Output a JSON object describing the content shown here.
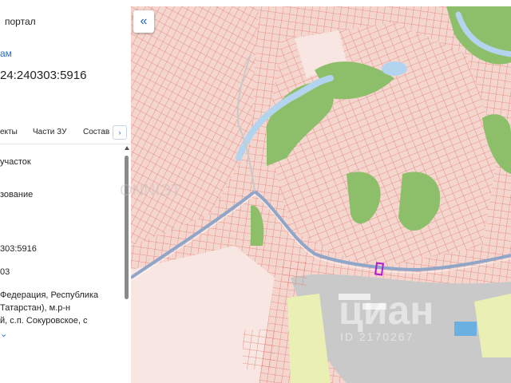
{
  "panel": {
    "portal": "портал",
    "link": "ам",
    "cadastral_number": "24:240303:5916",
    "tabs": [
      "екты",
      "Части ЗУ",
      "Состав"
    ],
    "tab_next_arrow": "›",
    "fields": [
      "участок",
      "зование",
      "303:5916",
      "03"
    ],
    "address_lines": [
      "Федерация, Республика",
      "Татарстан), м.р-н",
      "й, с.п. Сокуровское, с"
    ],
    "expand_chevron": "⌄"
  },
  "map": {
    "collapse_button": "«",
    "watermark_main": "циан",
    "watermark_sub": "ID 2170267",
    "watermark_left": "ONNIЭТ"
  },
  "colors": {
    "parcel_fill": "#f4d6cf",
    "parcel_line": "#e07a70",
    "forest": "#8dbf6b",
    "water": "#b3d4ee",
    "road": "#8fa6c9",
    "industrial": "#c9c9c9",
    "field": "#eaf0b3",
    "selected_parcel": "#b11bd1"
  }
}
